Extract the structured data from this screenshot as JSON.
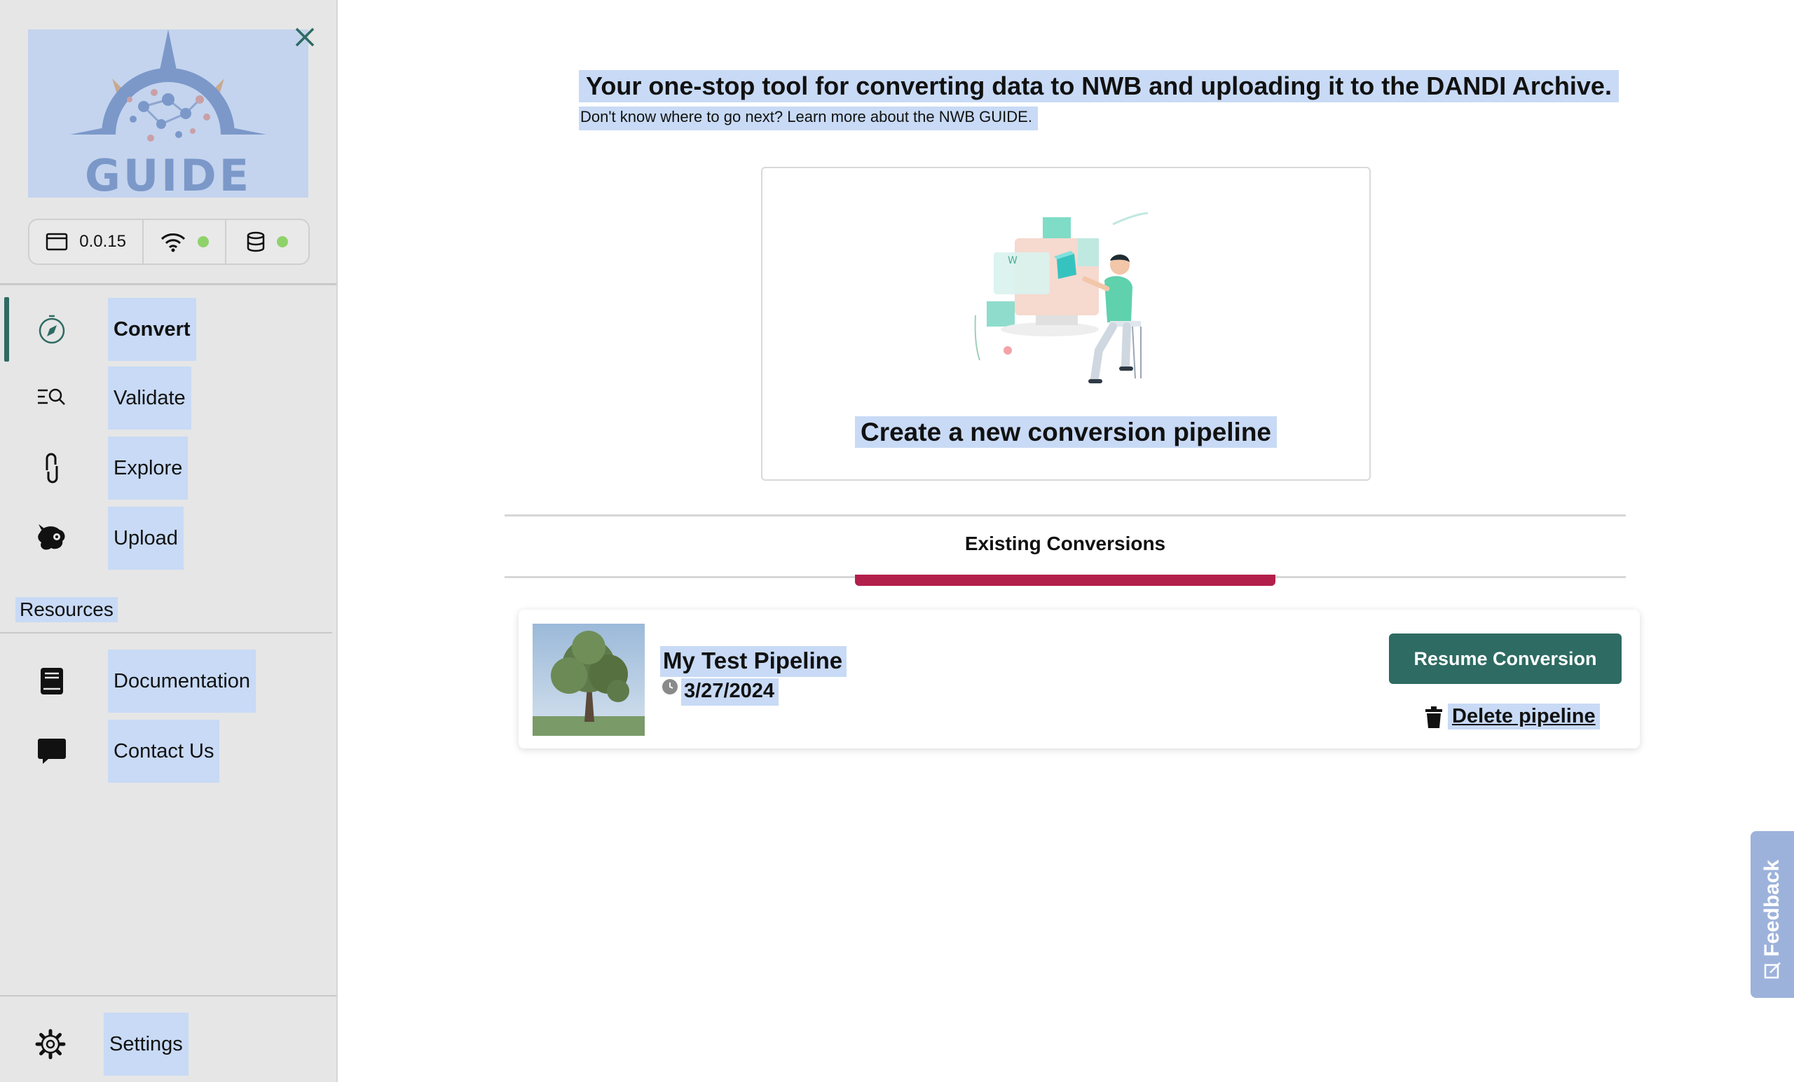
{
  "sidebar": {
    "version": "0.0.15",
    "nav": [
      {
        "label": "Convert",
        "icon": "compass-icon"
      },
      {
        "label": "Validate",
        "icon": "search-list-icon"
      },
      {
        "label": "Explore",
        "icon": "link-icon"
      },
      {
        "label": "Upload",
        "icon": "dandi-icon"
      }
    ],
    "resources_title": "Resources",
    "resources": [
      {
        "label": "Documentation",
        "icon": "book-icon"
      },
      {
        "label": "Contact Us",
        "icon": "chat-icon"
      }
    ],
    "settings_label": "Settings",
    "status_colors": {
      "online": "#8fd26a"
    }
  },
  "main": {
    "headline": "Your one-stop tool for converting data to NWB and uploading it to the DANDI Archive.",
    "subline": "Don't know where to go next? Learn more about the NWB GUIDE.",
    "new_pipeline_label": "Create a new conversion pipeline",
    "section_tab": "Existing Conversions",
    "pipeline": {
      "name": "My Test Pipeline",
      "date": "3/27/2024",
      "resume_label": "Resume Conversion",
      "delete_label": "Delete pipeline"
    }
  },
  "feedback_label": "Feedback",
  "colors": {
    "accent": "#2e6b62",
    "tab_indicator": "#b31f4b",
    "highlight": "#c8daf5"
  }
}
